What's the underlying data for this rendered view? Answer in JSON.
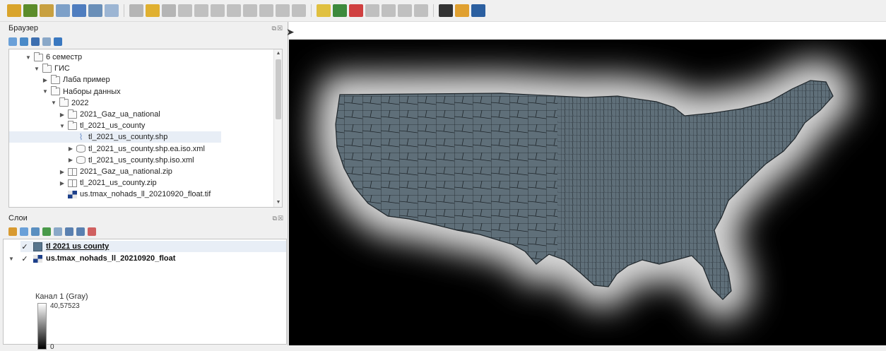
{
  "toolbar": {
    "buttons": [
      {
        "icon": "add-vector-icon",
        "color": "#d9a42b"
      },
      {
        "icon": "add-raster-icon",
        "color": "#5b8c2a"
      },
      {
        "icon": "add-delimited-icon",
        "color": "#c8a040"
      },
      {
        "icon": "add-spatialite-icon",
        "color": "#7da0c8"
      },
      {
        "icon": "add-postgis-icon",
        "color": "#4f7dbf"
      },
      {
        "icon": "add-wms-icon",
        "color": "#6a8fb8"
      },
      {
        "icon": "add-wcs-icon",
        "color": "#9cb5d3"
      },
      {
        "icon": "digitize-icon",
        "color": "#b5b5b5"
      },
      {
        "icon": "pencil-icon",
        "color": "#e0b030"
      },
      {
        "icon": "save-edits-icon",
        "color": "#b5b5b5"
      },
      {
        "icon": "add-feature-icon",
        "color": "#c0c0c0"
      },
      {
        "icon": "node-tool-icon",
        "color": "#c0c0c0"
      },
      {
        "icon": "delete-feature-icon",
        "color": "#c0c0c0"
      },
      {
        "icon": "cut-feature-icon",
        "color": "#c0c0c0"
      },
      {
        "icon": "copy-feature-icon",
        "color": "#c0c0c0"
      },
      {
        "icon": "paste-feature-icon",
        "color": "#c0c0c0"
      },
      {
        "icon": "undo-icon",
        "color": "#c0c0c0"
      },
      {
        "icon": "redo-icon",
        "color": "#c0c0c0"
      },
      {
        "icon": "label-icon",
        "color": "#e0c040"
      },
      {
        "icon": "label-pin-icon",
        "color": "#3d8a3d"
      },
      {
        "icon": "label-show-icon",
        "color": "#d04040"
      },
      {
        "icon": "label-move-icon",
        "color": "#c0c0c0"
      },
      {
        "icon": "label-rotate-icon",
        "color": "#c0c0c0"
      },
      {
        "icon": "label-change-icon",
        "color": "#c0c0c0"
      },
      {
        "icon": "label-props-icon",
        "color": "#c0c0c0"
      },
      {
        "icon": "python-icon",
        "color": "#333333"
      },
      {
        "icon": "plugin-icon",
        "color": "#e0a030"
      },
      {
        "icon": "grass-icon",
        "color": "#2b5fa0"
      }
    ]
  },
  "browser": {
    "title": "Браузер",
    "controls": "⧉☒",
    "tools": [
      "add-selected-icon",
      "refresh-icon",
      "filter-icon",
      "collapse-icon",
      "info-icon"
    ],
    "items": [
      {
        "label": "6 семестр",
        "indent": 0,
        "arrow": "▼",
        "icon": "folder"
      },
      {
        "label": "ГИС",
        "indent": 1,
        "arrow": "▼",
        "icon": "folder"
      },
      {
        "label": "Лаба пример",
        "indent": 2,
        "arrow": "▶",
        "icon": "folder"
      },
      {
        "label": "Наборы данных",
        "indent": 2,
        "arrow": "▼",
        "icon": "folder"
      },
      {
        "label": "2022",
        "indent": 3,
        "arrow": "▼",
        "icon": "folder"
      },
      {
        "label": "2021_Gaz_ua_national",
        "indent": 4,
        "arrow": "▶",
        "icon": "folder"
      },
      {
        "label": "tl_2021_us_county",
        "indent": 4,
        "arrow": "▼",
        "icon": "folder"
      },
      {
        "label": "tl_2021_us_county.shp",
        "indent": 5,
        "arrow": "",
        "icon": "shp",
        "selected": true
      },
      {
        "label": "tl_2021_us_county.shp.ea.iso.xml",
        "indent": 5,
        "arrow": "▶",
        "icon": "db"
      },
      {
        "label": "tl_2021_us_county.shp.iso.xml",
        "indent": 5,
        "arrow": "▶",
        "icon": "db"
      },
      {
        "label": "2021_Gaz_ua_national.zip",
        "indent": 4,
        "arrow": "▶",
        "icon": "zip"
      },
      {
        "label": "tl_2021_us_county.zip",
        "indent": 4,
        "arrow": "▶",
        "icon": "zip"
      },
      {
        "label": "us.tmax_nohads_ll_20210920_float.tif",
        "indent": 4,
        "arrow": "",
        "icon": "tif"
      }
    ]
  },
  "layers_panel": {
    "title": "Слои",
    "controls": "⧉☒",
    "tools": [
      "style-icon",
      "add-group-icon",
      "visibility-icon",
      "filter-legend-icon",
      "expression-icon",
      "expand-icon",
      "collapse-icon",
      "remove-layer-icon"
    ],
    "layers": [
      {
        "name": "tl 2021 us county",
        "checked": "✓",
        "type": "vector",
        "fill_color": "#59768e"
      },
      {
        "name": "us.tmax_nohads_ll_20210920_float",
        "checked": "✓",
        "type": "raster"
      }
    ],
    "band_label": "Канал 1 (Gray)",
    "ramp_max": "40,57523",
    "ramp_min": "0"
  },
  "map": {
    "background": "#000000",
    "county_fill": "#5f6f79",
    "county_stroke": "#1f262b"
  }
}
